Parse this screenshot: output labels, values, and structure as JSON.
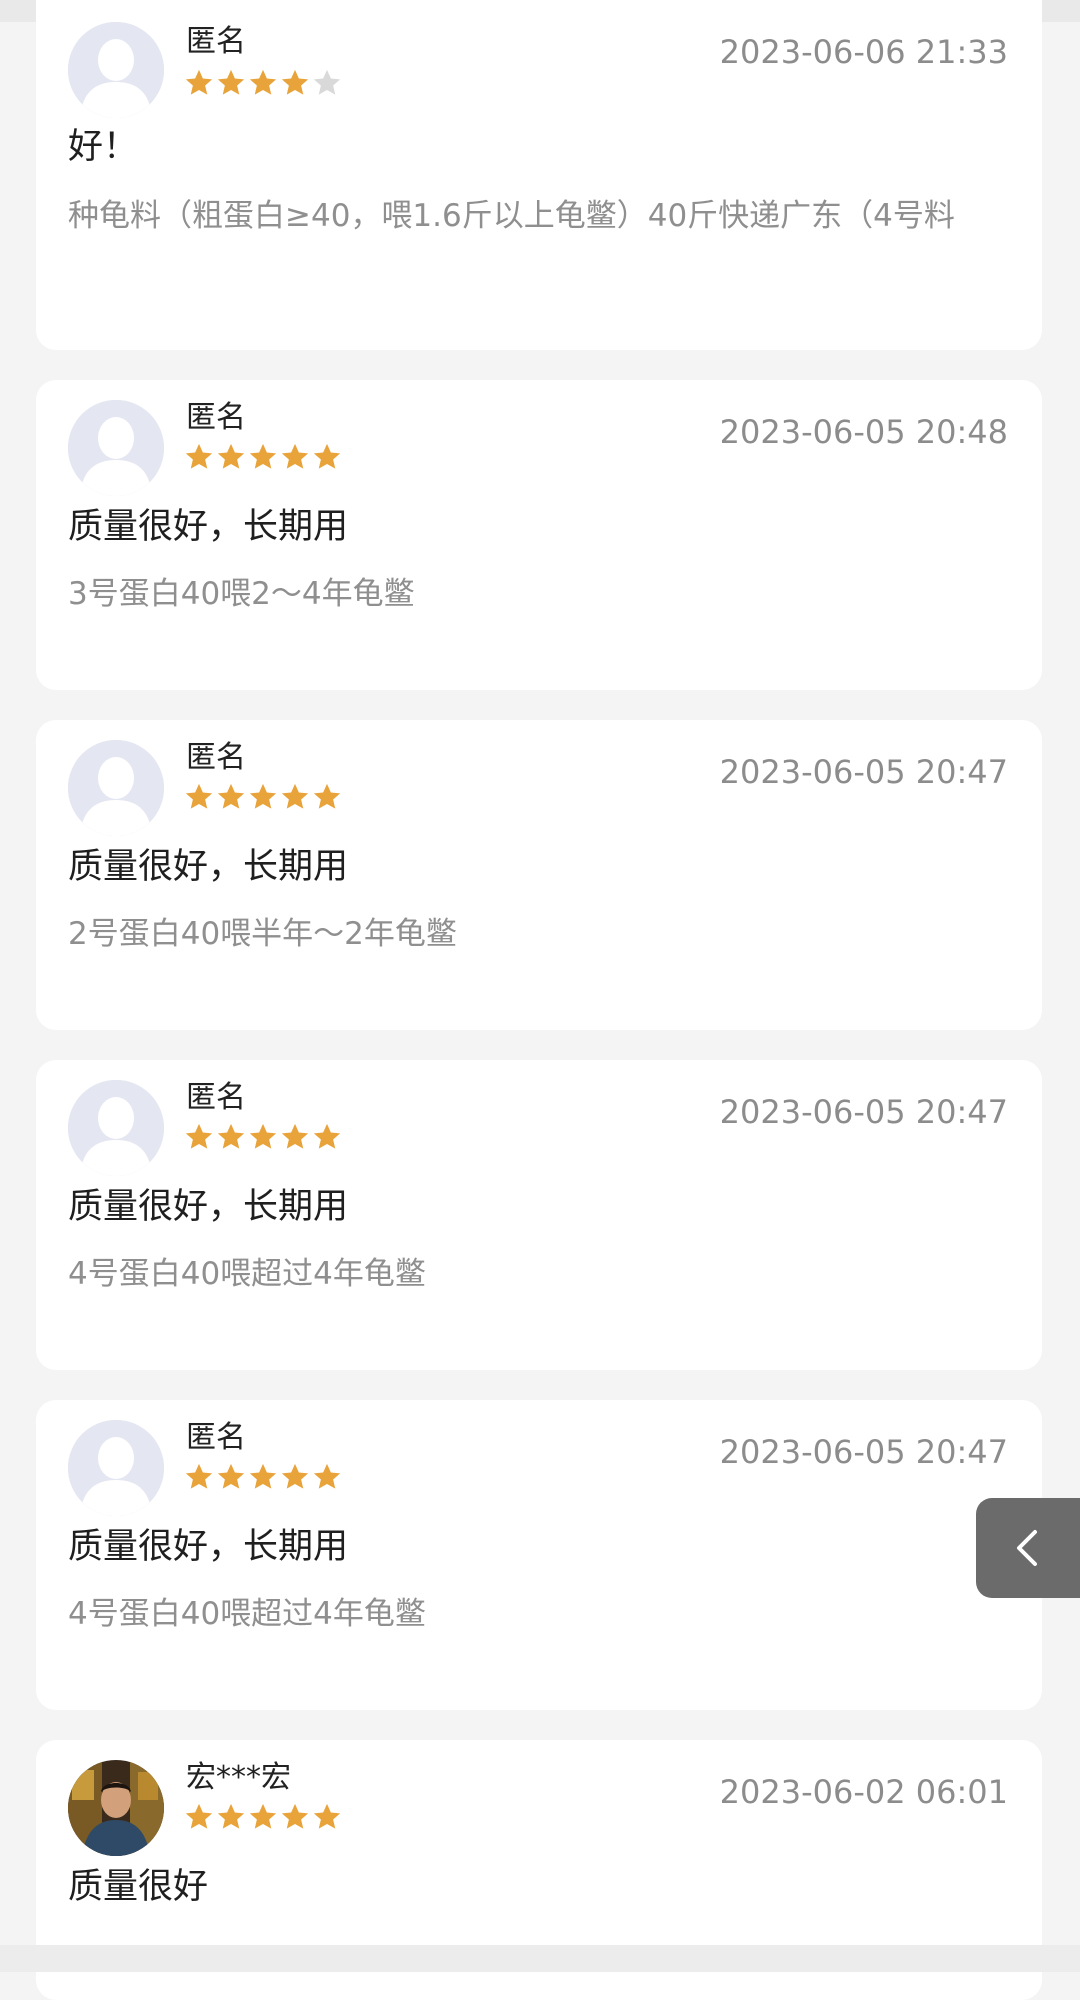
{
  "colors": {
    "star_filled": "#e8a33a",
    "star_empty": "#d9d9d9",
    "date_text": "#8c8c8c",
    "spec_text": "#8f8f8f",
    "avatar_placeholder": "#e4e6f1"
  },
  "reviews": [
    {
      "name": "匿名",
      "rating": 4,
      "date": "2023-06-06 21:33",
      "text": "好！",
      "spec": "种龟料（粗蛋白≥40，喂1.6斤以上龟鳖）40斤快递广东（4号料",
      "avatar": "default-avatar-icon"
    },
    {
      "name": "匿名",
      "rating": 5,
      "date": "2023-06-05 20:48",
      "text": "质量很好，长期用",
      "spec": "3号蛋白40喂2～4年龟鳖",
      "avatar": "default-avatar-icon"
    },
    {
      "name": "匿名",
      "rating": 5,
      "date": "2023-06-05 20:47",
      "text": "质量很好，长期用",
      "spec": "2号蛋白40喂半年～2年龟鳖",
      "avatar": "default-avatar-icon"
    },
    {
      "name": "匿名",
      "rating": 5,
      "date": "2023-06-05 20:47",
      "text": "质量很好，长期用",
      "spec": "4号蛋白40喂超过4年龟鳖",
      "avatar": "default-avatar-icon"
    },
    {
      "name": "匿名",
      "rating": 5,
      "date": "2023-06-05 20:47",
      "text": "质量很好，长期用",
      "spec": "4号蛋白40喂超过4年龟鳖",
      "avatar": "default-avatar-icon"
    },
    {
      "name": "宏***宏",
      "rating": 5,
      "date": "2023-06-02 06:01",
      "text": "质量很好",
      "spec": "",
      "avatar": "user-photo-icon"
    }
  ],
  "back_button": {
    "icon": "chevron-left-icon"
  }
}
